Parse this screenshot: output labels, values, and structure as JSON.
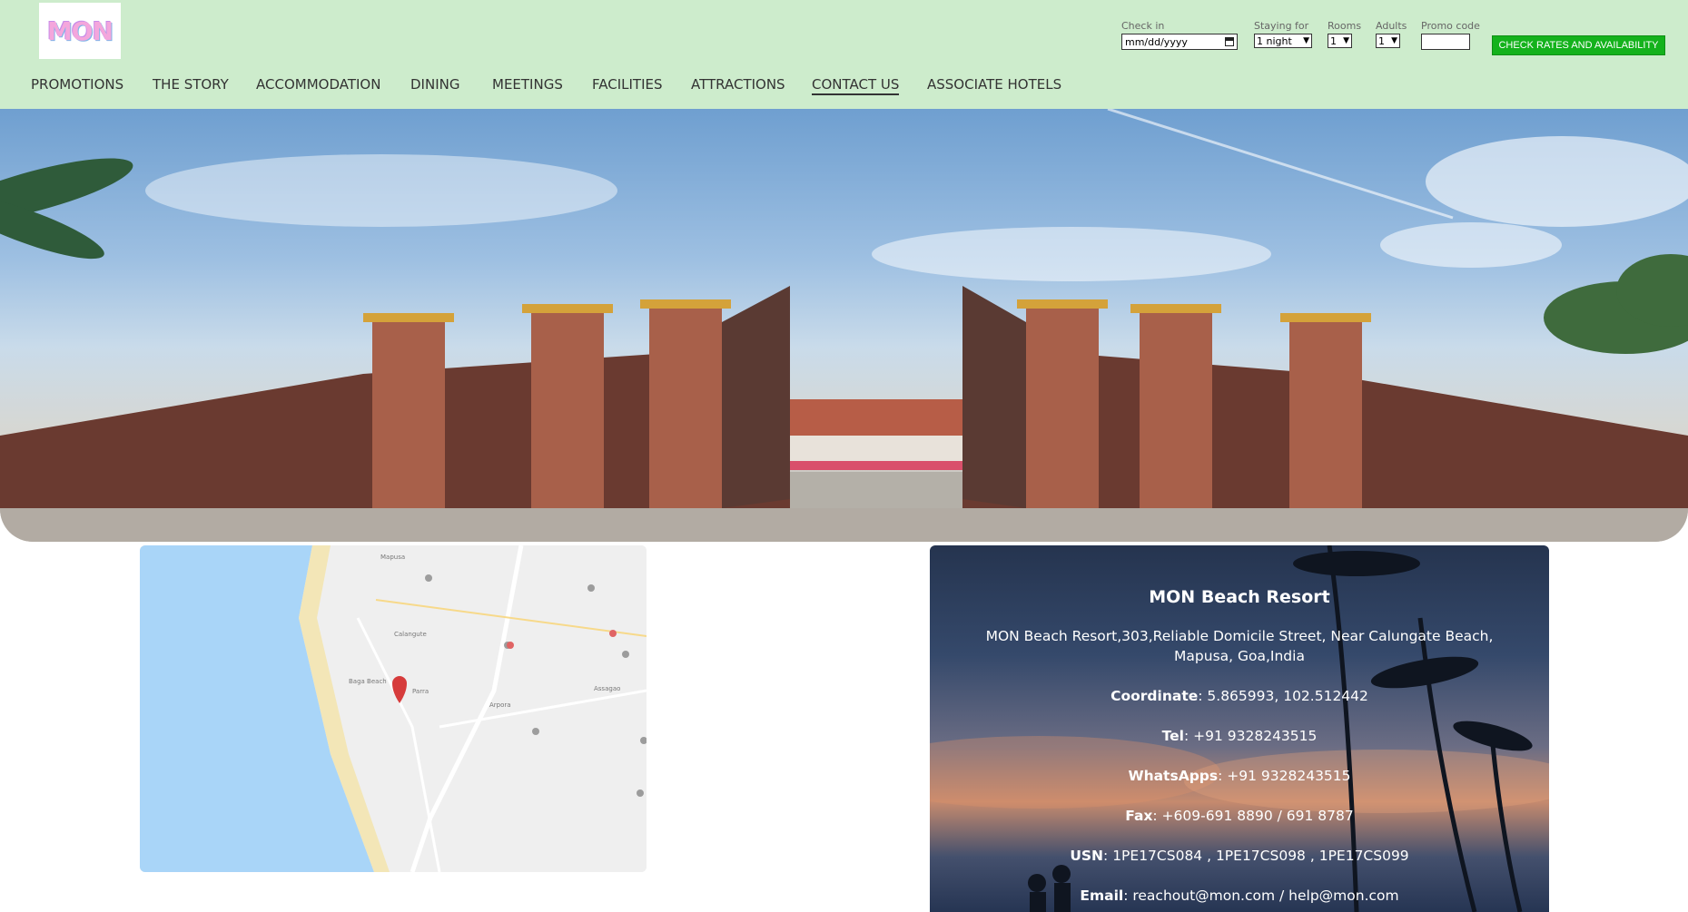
{
  "brand": {
    "logo_text": "MON"
  },
  "booking": {
    "checkin_label": "Check in",
    "checkin_placeholder": "mm/dd/yyyy",
    "staying_label": "Staying for",
    "staying_value": "1 night",
    "rooms_label": "Rooms",
    "rooms_value": "1",
    "adults_label": "Adults",
    "adults_value": "1",
    "promo_label": "Promo code",
    "promo_value": "",
    "check_button": "CHECK RATES AND AVAILABILITY"
  },
  "nav": {
    "items": [
      {
        "label": "PROMOTIONS"
      },
      {
        "label": "THE STORY"
      },
      {
        "label": "ACCOMMODATION"
      },
      {
        "label": "DINING"
      },
      {
        "label": "MEETINGS"
      },
      {
        "label": "FACILITIES"
      },
      {
        "label": "ATTRACTIONS"
      },
      {
        "label": "CONTACT US"
      },
      {
        "label": "ASSOCIATE HOTELS"
      }
    ],
    "active": "CONTACT US"
  },
  "map": {
    "labels": [
      "Mapusa",
      "Calangute",
      "Baga Beach",
      "Parra",
      "Arpora",
      "Assagao"
    ]
  },
  "contact": {
    "title": "MON Beach Resort",
    "address_line1": "MON Beach Resort,303,Reliable Domicile Street, Near Calungate Beach,",
    "address_line2": "Mapusa, Goa,India",
    "coordinate_label": "Coordinate",
    "coordinate_value": ": 5.865993, 102.512442",
    "tel_label": "Tel",
    "tel_value": ": +91 9328243515",
    "whatsapp_label": "WhatsApps",
    "whatsapp_value": ": +91 9328243515",
    "fax_label": "Fax",
    "fax_value": ": +609-691 8890 / 691 8787",
    "usn_label": "USN",
    "usn_value": ": 1PE17CS084 , 1PE17CS098 , 1PE17CS099",
    "email_label": "Email",
    "email_value": ": reachout@mon.com / help@mon.com"
  },
  "colors": {
    "header_bg": "#cdeccc",
    "button_green": "#14b21c",
    "nav_text": "#333333"
  }
}
